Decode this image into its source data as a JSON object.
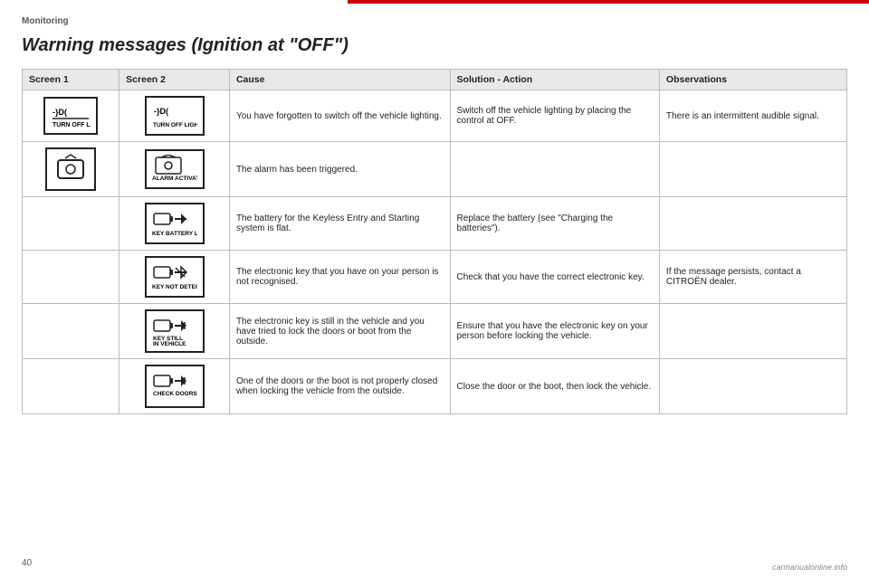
{
  "section": "Monitoring",
  "title": "Warning messages (Ignition at \"OFF\")",
  "table": {
    "headers": [
      "Screen 1",
      "Screen 2",
      "Cause",
      "Solution - Action",
      "Observations"
    ],
    "rows": [
      {
        "screen1_label": "TURN OFF\nLIGHTS",
        "screen1_icon": "turn_off_lights",
        "screen2_label": "TURN OFF LIGHTS",
        "screen2_icon": "turn_off_lights2",
        "cause": "You have forgotten to switch off the vehicle lighting.",
        "solution": "Switch off the vehicle lighting by placing the control at OFF.",
        "observations": "There is an intermittent audible signal."
      },
      {
        "screen1_label": "",
        "screen1_icon": "alarm",
        "screen2_label": "ALARM ACTIVATING",
        "screen2_icon": "alarm2",
        "cause": "The alarm has been triggered.",
        "solution": "",
        "observations": ""
      },
      {
        "screen1_label": "",
        "screen1_icon": "",
        "screen2_label": "KEY BATTERY LOW",
        "screen2_icon": "key_battery",
        "cause": "The battery for the Keyless Entry and Starting system is flat.",
        "solution": "Replace the battery (see \"Charging the batteries\").",
        "observations": ""
      },
      {
        "screen1_label": "",
        "screen1_icon": "",
        "screen2_label": "KEY NOT DETECTED",
        "screen2_icon": "key_not_detected",
        "cause": "The electronic key that you have on your person is not recognised.",
        "solution": "Check that you have the correct electronic key.",
        "observations": "If the message persists, contact a CITROËN dealer."
      },
      {
        "screen1_label": "",
        "screen1_icon": "",
        "screen2_label": "KEY STILL\nIN VEHICLE",
        "screen2_icon": "key_still",
        "cause": "The electronic key is still in the vehicle and you have tried to lock the doors or boot from the outside.",
        "solution": "Ensure that you have the electronic key on your person before locking the vehicle.",
        "observations": ""
      },
      {
        "screen1_label": "",
        "screen1_icon": "",
        "screen2_label": "CHECK DOORS",
        "screen2_icon": "check_doors",
        "cause": "One of the doors or the boot is not properly closed when locking the vehicle from the outside.",
        "solution": "Close the door or the boot, then lock the vehicle.",
        "observations": ""
      }
    ]
  },
  "page_number": "40"
}
